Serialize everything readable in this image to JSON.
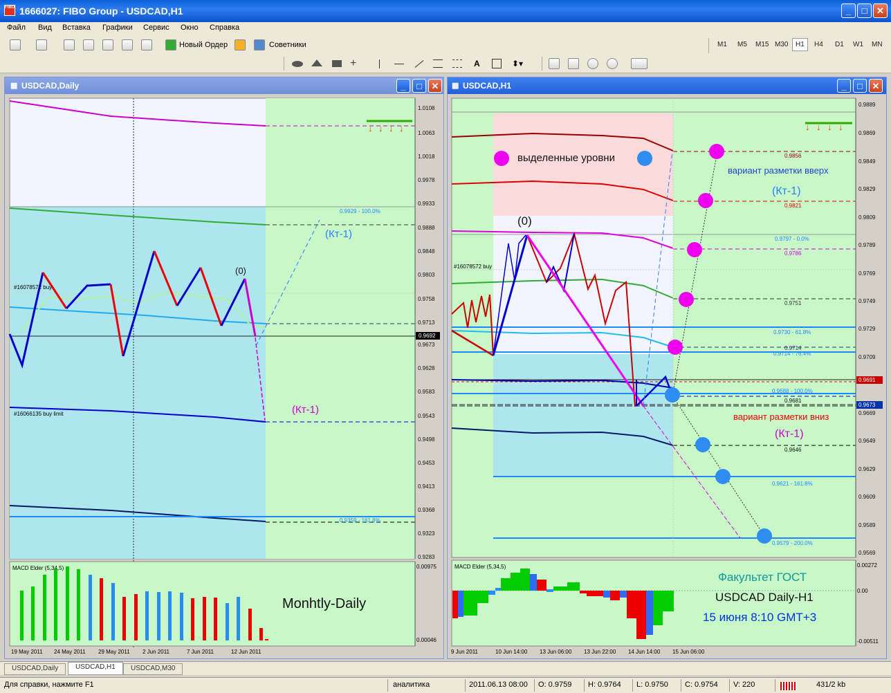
{
  "window": {
    "title": "1666027: FIBO Group - USDCAD,H1",
    "app_icon": "fibo-logo-icon"
  },
  "menu": [
    "Файл",
    "Вид",
    "Вставка",
    "Графики",
    "Сервис",
    "Окно",
    "Справка"
  ],
  "toolbar": {
    "new_order": "Новый Ордер",
    "advisors": "Советники",
    "timeframes": [
      "M1",
      "M5",
      "M15",
      "M30",
      "H1",
      "H4",
      "D1",
      "W1",
      "MN"
    ],
    "selected_tf": "H1",
    "text_tool": "A"
  },
  "left_chart": {
    "title": "USDCAD,Daily",
    "price_axis": [
      "1.0108",
      "1.0063",
      "1.0018",
      "0.9978",
      "0.9933",
      "0.9888",
      "0.9848",
      "0.9803",
      "0.9758",
      "0.9713",
      "0.9673",
      "0.9628",
      "0.9583",
      "0.9543",
      "0.9498",
      "0.9453",
      "0.9413",
      "0.9368",
      "0.9323",
      "0.9283"
    ],
    "current_price": "0.9692",
    "date_axis": [
      "19 May 2011",
      "24 May 2011",
      "29 May 2011",
      "2 Jun 2011",
      "7 Jun 2011",
      "12 Jun 2011"
    ],
    "order_labels": [
      "#16078572 buy",
      "#16066135 buy limit"
    ],
    "fib_labels": [
      "0.9929 - 100.0%",
      "0.9359 - 161.8%"
    ],
    "annotations": [
      "(Кт-1)",
      "(0)",
      "(Кт-1)"
    ],
    "indicator": {
      "name": "MACD Elder (5,34,5)",
      "axis_top": "0.00975",
      "axis_bottom": "0.00046",
      "caption": "Monhtly-Daily"
    }
  },
  "right_chart": {
    "title": "USDCAD,H1",
    "price_axis": [
      "0.9889",
      "0.9869",
      "0.9849",
      "0.9829",
      "0.9809",
      "0.9789",
      "0.9769",
      "0.9749",
      "0.9729",
      "0.9709",
      "0.9669",
      "0.9649",
      "0.9629",
      "0.9609",
      "0.9589",
      "0.9569"
    ],
    "price_tags": [
      "0.9691",
      "0.9673"
    ],
    "date_axis": [
      "9 Jun 2011",
      "10 Jun 14:00",
      "13 Jun 06:00",
      "13 Jun 22:00",
      "14 Jun 14:00",
      "15 Jun 06:00"
    ],
    "level_labels": [
      "0.9856",
      "0.9821",
      "0.9797 - 0.0%",
      "0.9786",
      "0.9751",
      "0.9730 - 61.8%",
      "0.9714",
      "0.9714 - 76.4%",
      "0.9688 - 100.0%",
      "0.9681",
      "0.9646",
      "0.9621 - 161.8%",
      "0.9579 - 200.0%"
    ],
    "order_label": "#16078572 buy",
    "legend_text": "выделенные уровни",
    "variant_up": "вариант разметки вверх",
    "variant_down": "вариант разметки вниз",
    "kt_up": "(Кт-1)",
    "kt_down": "(Кт-1)",
    "zero": "(0)",
    "indicator": {
      "name": "MACD Elder (5,34,5)",
      "axis_top": "0.00272",
      "axis_mid": "0.00",
      "axis_bottom": "-0.00511"
    },
    "caption": [
      "Факультет ГОСТ",
      "USDCAD Daily-H1",
      "15 июня 8:10 GMT+3"
    ]
  },
  "tabs": [
    "USDCAD,Daily",
    "USDCAD,H1",
    "USDCAD,M30"
  ],
  "active_tab": "USDCAD,H1",
  "status": {
    "help": "Для справки, нажмите F1",
    "profile": "аналитика",
    "datetime": "2011.06.13 08:00",
    "open": "O: 0.9759",
    "high": "H: 0.9764",
    "low": "L: 0.9750",
    "close": "C: 0.9754",
    "volume": "V: 220",
    "traffic": "431/2 kb"
  },
  "colors": {
    "bull": "#ff0000",
    "bear": "#0000cc",
    "green_zone": "#c8f7c8",
    "blue_zone": "#aee6ee",
    "pink_zone": "#fadada",
    "magenta": "#ff00ff",
    "dot_blue": "#2f8cf0"
  }
}
